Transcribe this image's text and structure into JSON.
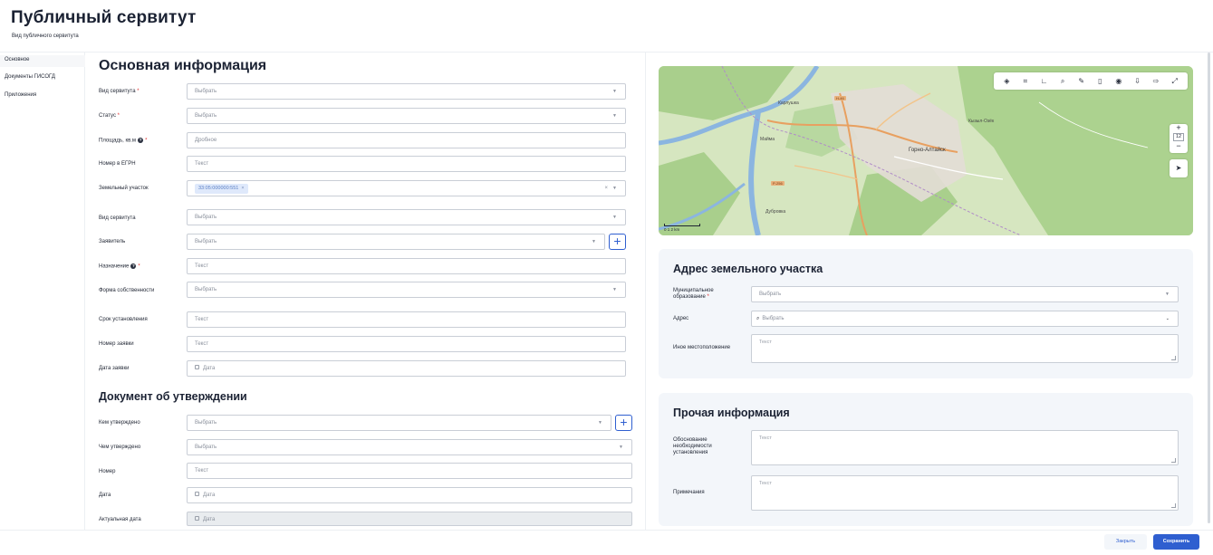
{
  "header": {
    "title": "Публичный сервитут",
    "subtitle": "Вид публичного сервитута"
  },
  "nav": {
    "items": [
      {
        "label": "Основное",
        "active": true
      },
      {
        "label": "Документы ГИСОГД",
        "active": false
      },
      {
        "label": "Приложения",
        "active": false
      }
    ]
  },
  "main": {
    "title": "Основная информация",
    "fields": {
      "servitude_type": {
        "label": "Вид сервитута",
        "required": "*",
        "value": "Выбрать"
      },
      "status": {
        "label": "Статус",
        "required": "*",
        "value": "Выбрать"
      },
      "area": {
        "label": "Площадь, кв.м",
        "required": "*",
        "placeholder": "Дробное"
      },
      "egrn": {
        "label": "Номер в ЕГРН",
        "placeholder": "Текст"
      },
      "land_plot": {
        "label": "Земельный участок",
        "tag": "33:05:000000:551",
        "clear": "×",
        "tag_remove": "×"
      },
      "servitude_kind": {
        "label": "Вид сервитута",
        "value": "Выбрать"
      },
      "applicant": {
        "label": "Заявитель",
        "value": "Выбрать"
      },
      "purpose": {
        "label": "Назначение",
        "required": "*",
        "placeholder": "Текст"
      },
      "ownership": {
        "label": "Форма собственности",
        "value": "Выбрать"
      },
      "term": {
        "label": "Срок установления",
        "placeholder": "Текст"
      },
      "app_number": {
        "label": "Номер заявки",
        "placeholder": "Текст"
      },
      "app_date": {
        "label": "Дата заявки",
        "placeholder": "Дата"
      }
    }
  },
  "approval": {
    "title": "Документ об утверждении",
    "fields": {
      "approved_by": {
        "label": "Кем утверждено",
        "value": "Выбрать"
      },
      "approved_with": {
        "label": "Чем утверждено",
        "value": "Выбрать"
      },
      "number": {
        "label": "Номер",
        "placeholder": "Текст"
      },
      "date": {
        "label": "Дата",
        "placeholder": "Дата"
      },
      "actual_date": {
        "label": "Актуальная дата",
        "placeholder": "Дата"
      }
    }
  },
  "map": {
    "zoom": "12",
    "zoom_in": "+",
    "zoom_out": "−",
    "scale": "2 km",
    "scale_ticks": "0   1   2 km",
    "labels": {
      "city": "Горно-Алтайск",
      "n1": "Карлушка",
      "n2": "Кызыл-Озёк",
      "n3": "Майма",
      "n4": "Дубровка"
    },
    "road_tags": [
      "Р-256",
      "Н-46"
    ]
  },
  "address": {
    "title": "Адрес земельного участка",
    "municipality": {
      "label": "Муниципальное образование",
      "required": "*",
      "value": "Выбрать"
    },
    "address": {
      "label": "Адрес",
      "value": "Выбрать"
    },
    "other_location": {
      "label": "Иное местоположение",
      "placeholder": "Текст"
    }
  },
  "other": {
    "title": "Прочая информация",
    "justification": {
      "label": "Обоснование необходимости установления",
      "placeholder": "Текст"
    },
    "notes": {
      "label": "Примечания",
      "placeholder": "Текст"
    }
  },
  "footer": {
    "close_label": "Закрыть",
    "save_label": "Сохранить"
  },
  "colors": {
    "accent": "#2f5fd0",
    "required": "#e0302f",
    "panel_bg": "#f3f6fa"
  }
}
